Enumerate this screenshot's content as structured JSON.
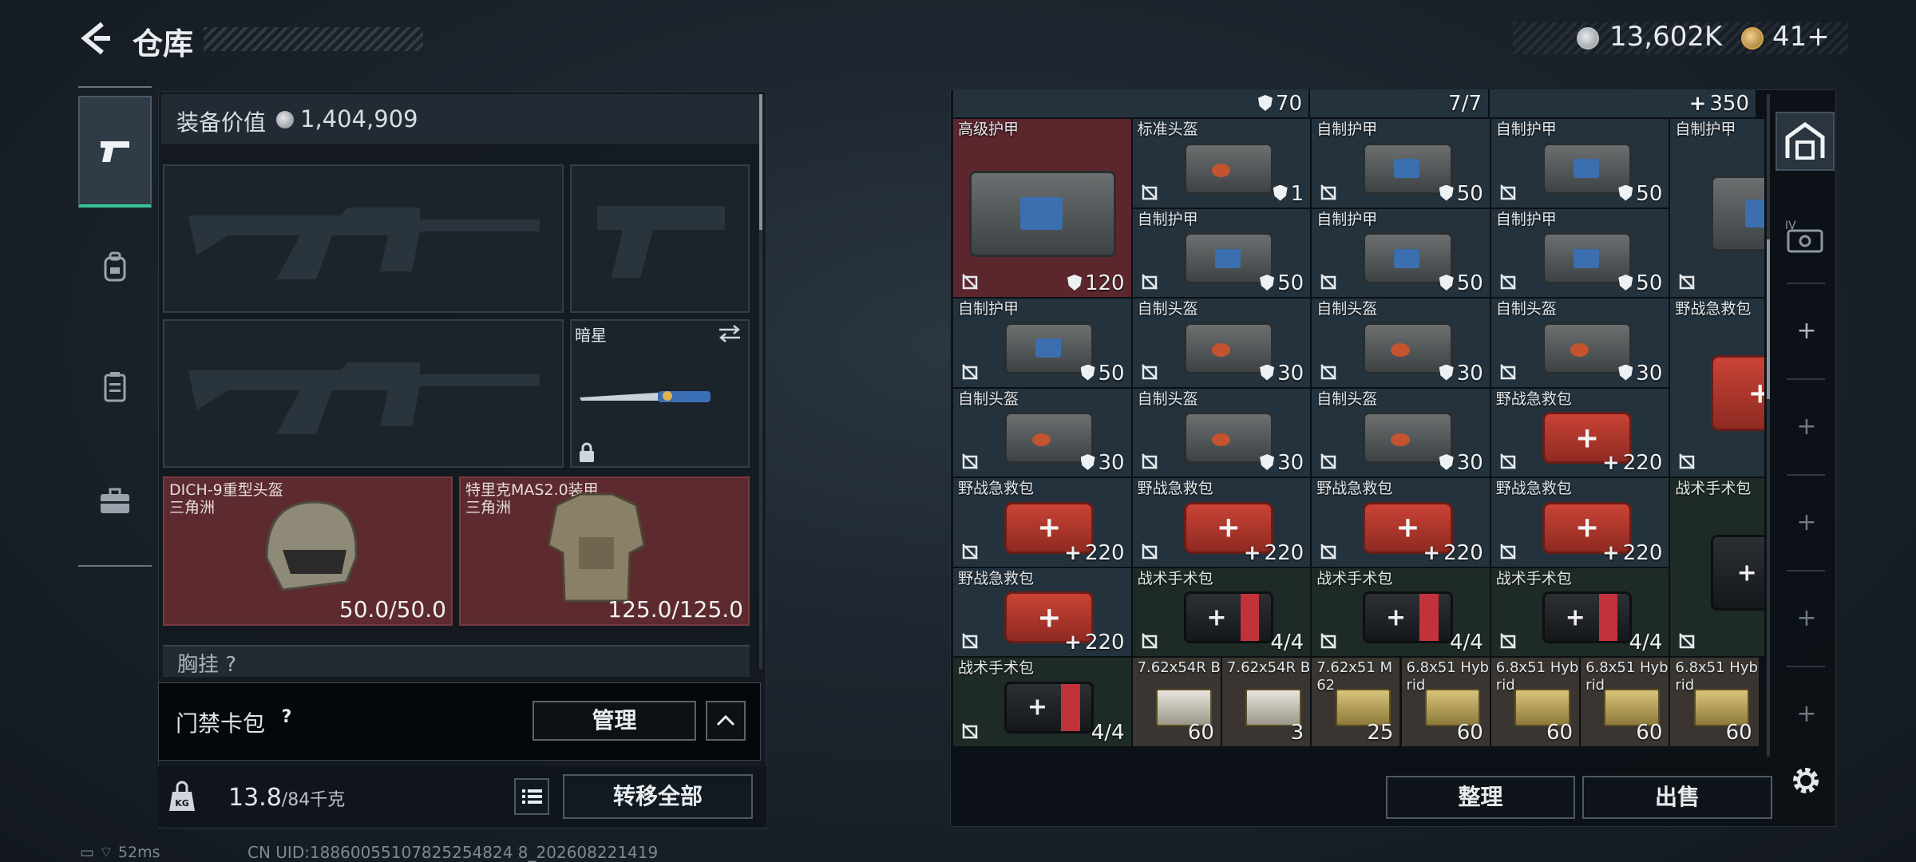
{
  "header": {
    "title": "仓库",
    "currency1": "13,602K",
    "currency2": "41+"
  },
  "loadout": {
    "value_label": "装备价值",
    "value": "1,404,909",
    "melee_name": "暗星",
    "helmet": {
      "name": "DICH-9重型头盔",
      "origin": "三角洲",
      "durability": "50.0/50.0"
    },
    "armor": {
      "name": "特里克MAS2.0装甲",
      "origin": "三角洲",
      "durability": "125.0/125.0"
    },
    "chest_label": "胸挂 ?",
    "card_label": "门禁卡包",
    "card_help": "?",
    "manage_button": "管理",
    "weight_value": "13.8",
    "weight_max": "/84千克",
    "transfer_button": "转移全部"
  },
  "stash": {
    "top_row": [
      {
        "count": "70",
        "badge": "shield"
      },
      {
        "count": "7/7",
        "badge": ""
      },
      {
        "count": "350",
        "badge": "plus"
      }
    ],
    "items": [
      {
        "name": "高级护甲",
        "count": "120",
        "badge": "shield",
        "bg": "red",
        "art": "vest"
      },
      {
        "name": "标准头盔",
        "count": "1",
        "badge": "shield",
        "bg": "blue",
        "art": "helm"
      },
      {
        "name": "自制护甲",
        "count": "50",
        "badge": "shield",
        "bg": "blue",
        "art": "vest"
      },
      {
        "name": "自制护甲",
        "count": "50",
        "badge": "shield",
        "bg": "blue",
        "art": "vest"
      },
      {
        "name": "自制护甲",
        "count": "50",
        "badge": "shield",
        "bg": "blue",
        "art": "vest"
      },
      {
        "name": "自制护甲",
        "count": "50",
        "badge": "shield",
        "bg": "blue",
        "art": "vest"
      },
      {
        "name": "自制护甲",
        "count": "50",
        "badge": "shield",
        "bg": "blue",
        "art": "vest"
      },
      {
        "name": "自制护甲",
        "count": "50",
        "badge": "shield",
        "bg": "blue",
        "art": "vest"
      },
      {
        "name": "自制护甲",
        "count": "50",
        "badge": "shield",
        "bg": "blue",
        "art": "vest"
      },
      {
        "name": "自制头盔",
        "count": "30",
        "badge": "shield",
        "bg": "blue",
        "art": "helm"
      },
      {
        "name": "自制头盔",
        "count": "30",
        "badge": "shield",
        "bg": "blue",
        "art": "helm"
      },
      {
        "name": "自制头盔",
        "count": "30",
        "badge": "shield",
        "bg": "blue",
        "art": "helm"
      },
      {
        "name": "野战急救包",
        "count": "220",
        "badge": "plus",
        "bg": "blue",
        "art": "med"
      },
      {
        "name": "自制头盔",
        "count": "30",
        "badge": "shield",
        "bg": "blue",
        "art": "helm"
      },
      {
        "name": "自制头盔",
        "count": "30",
        "badge": "shield",
        "bg": "blue",
        "art": "helm"
      },
      {
        "name": "自制头盔",
        "count": "30",
        "badge": "shield",
        "bg": "blue",
        "art": "helm"
      },
      {
        "name": "野战急救包",
        "count": "220",
        "badge": "plus",
        "bg": "blue",
        "art": "med"
      },
      {
        "name": "野战急救包",
        "count": "220",
        "badge": "plus",
        "bg": "blue",
        "art": "med"
      },
      {
        "name": "野战急救包",
        "count": "220",
        "badge": "plus",
        "bg": "blue",
        "art": "med"
      },
      {
        "name": "野战急救包",
        "count": "220",
        "badge": "plus",
        "bg": "blue",
        "art": "med"
      },
      {
        "name": "野战急救包",
        "count": "220",
        "badge": "plus",
        "bg": "blue",
        "art": "med"
      },
      {
        "name": "战术手术包",
        "count": "4/4",
        "badge": "",
        "bg": "green",
        "art": "pouch"
      },
      {
        "name": "野战急救包",
        "count": "220",
        "badge": "plus",
        "bg": "blue",
        "art": "med"
      },
      {
        "name": "战术手术包",
        "count": "4/4",
        "badge": "",
        "bg": "green",
        "art": "pouch"
      },
      {
        "name": "战术手术包",
        "count": "4/4",
        "badge": "",
        "bg": "green",
        "art": "pouch"
      },
      {
        "name": "战术手术包",
        "count": "4/4",
        "badge": "",
        "bg": "green",
        "art": "pouch"
      },
      {
        "name": "战术手术包",
        "count": "4/4",
        "badge": "",
        "bg": "green",
        "art": "pouch"
      },
      {
        "name": "7.62x54R B",
        "count": "60",
        "badge": "",
        "bg": "tan",
        "art": "ammo g"
      },
      {
        "name": "7.62x54R B",
        "count": "3",
        "badge": "",
        "bg": "tan",
        "art": "ammo g"
      },
      {
        "name": "7.62x51 M62",
        "count": "25",
        "badge": "",
        "bg": "tan",
        "art": "ammo"
      },
      {
        "name": "6.8x51 Hybrid",
        "count": "60",
        "badge": "",
        "bg": "tan",
        "art": "ammo"
      },
      {
        "name": "6.8x51 Hybrid",
        "count": "60",
        "badge": "",
        "bg": "tan",
        "art": "ammo"
      },
      {
        "name": "6.8x51 Hybrid",
        "count": "60",
        "badge": "",
        "bg": "tan",
        "art": "ammo"
      },
      {
        "name": "6.8x51 Hybrid",
        "count": "60",
        "badge": "",
        "bg": "tan",
        "art": "ammo"
      }
    ],
    "sort_button": "整理",
    "sell_button": "出售"
  },
  "status": {
    "ping": "52ms",
    "uid": "CN UID:18860055107825254824 8_202608221419"
  },
  "colors": {
    "accent": "#38c59c",
    "red_rarity": "#5b272d",
    "blue_item": "#24323d"
  }
}
